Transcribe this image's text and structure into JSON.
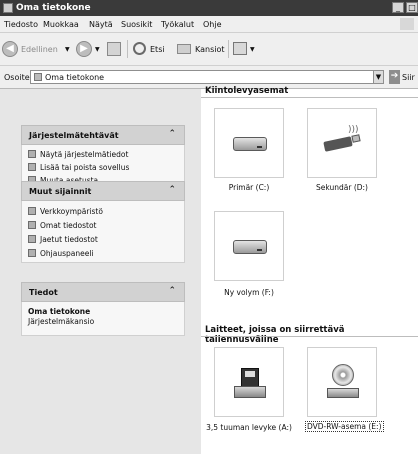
{
  "window": {
    "title": "Oma tietokone",
    "min_label": "_",
    "max_label": "□"
  },
  "menu": [
    "Tiedosto",
    "Muokkaa",
    "Näytä",
    "Suosikit",
    "Työkalut",
    "Ohje"
  ],
  "toolbar": {
    "back_label": "Edellinen",
    "search_label": "Etsi",
    "folders_label": "Kansiot"
  },
  "address": {
    "label": "Osoite",
    "value": "Oma tietokone",
    "go_label": "Siir"
  },
  "panels": {
    "system_tasks": {
      "title": "Järjestelmätehtävät",
      "items": [
        "Näytä järjestelmätiedot",
        "Lisää tai poista sovellus",
        "Muuta asetusta"
      ]
    },
    "other_places": {
      "title": "Muut sijainnit",
      "items": [
        "Verkkoympäristö",
        "Omat tiedostot",
        "Jaetut tiedostot",
        "Ohjauspaneeli"
      ]
    },
    "details": {
      "title": "Tiedot",
      "name": "Oma tietokone",
      "desc": "Järjestelmäkansio"
    }
  },
  "sections": {
    "hard_drives": {
      "label": "Kiintolevyasemat",
      "items": [
        "Primär (C:)",
        "Sekundär (D:)",
        "Ny volym (F:)"
      ]
    },
    "removable": {
      "label": "Laitteet, joissa on siirrettävä tallennusväline",
      "items": [
        "3,5 tuuman levyke (A:)",
        "DVD-RW-asema (E:)"
      ]
    }
  },
  "icons": {
    "back": "back-arrow-icon",
    "forward": "forward-arrow-icon",
    "up": "up-folder-icon",
    "search": "search-icon",
    "folders": "folders-icon",
    "views": "views-icon",
    "computer": "computer-icon",
    "go": "go-arrow-icon"
  },
  "colors": {
    "titlebar": "#3a3a3a",
    "sidepane": "#e6e6e6",
    "panel_header": "#d2d2d2"
  }
}
